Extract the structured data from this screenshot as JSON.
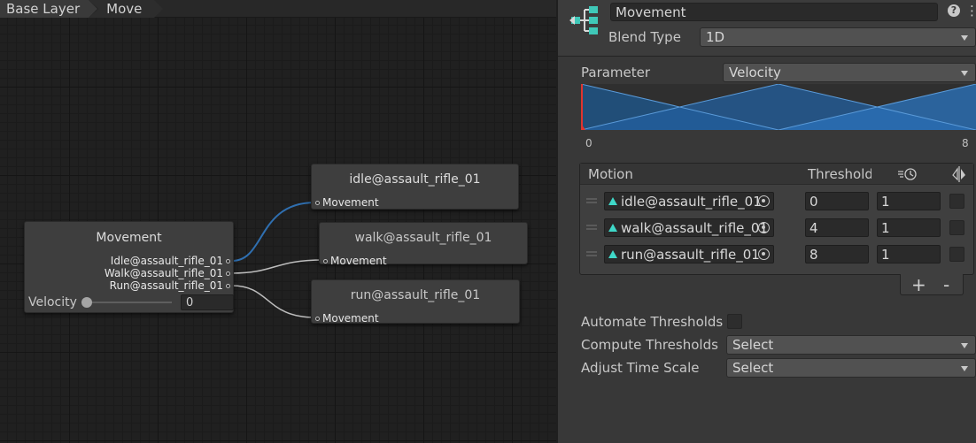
{
  "breadcrumb": {
    "items": [
      "Base Layer",
      "Move"
    ]
  },
  "graph": {
    "blend_node": {
      "title": "Movement",
      "outputs": [
        "Idle@assault_rifle_01",
        "Walk@assault_rifle_01",
        "Run@assault_rifle_01"
      ],
      "parameter_label": "Velocity",
      "parameter_value": "0"
    },
    "clip_nodes": [
      {
        "title": "idle@assault_rifle_01",
        "input": "Movement"
      },
      {
        "title": "walk@assault_rifle_01",
        "input": "Movement"
      },
      {
        "title": "run@assault_rifle_01",
        "input": "Movement"
      }
    ]
  },
  "inspector": {
    "name": "Movement",
    "blend_type_label": "Blend Type",
    "blend_type_value": "1D",
    "parameter_label": "Parameter",
    "parameter_value": "Velocity",
    "range_min": "0",
    "range_max": "8",
    "motion_table": {
      "header_motion": "Motion",
      "header_threshold": "Threshold",
      "rows": [
        {
          "clip": "idle@assault_rifle_01",
          "threshold": "0",
          "speed": "1"
        },
        {
          "clip": "walk@assault_rifle_01",
          "threshold": "4",
          "speed": "1"
        },
        {
          "clip": "run@assault_rifle_01",
          "threshold": "8",
          "speed": "1"
        }
      ],
      "add_label": "+",
      "remove_label": "-"
    },
    "automate_thresholds_label": "Automate Thresholds",
    "compute_thresholds_label": "Compute Thresholds",
    "compute_thresholds_value": "Select",
    "adjust_time_scale_label": "Adjust Time Scale",
    "adjust_time_scale_value": "Select"
  },
  "colors": {
    "accent_blue": "#2f6fb0",
    "clip_icon": "#3fd8c8",
    "marker_red": "#e0342f"
  },
  "icons": [
    "blend-tree-icon",
    "help-icon",
    "menu-dots-icon",
    "speed-icon",
    "mirror-icon",
    "object-picker-icon",
    "animation-clip-icon"
  ]
}
